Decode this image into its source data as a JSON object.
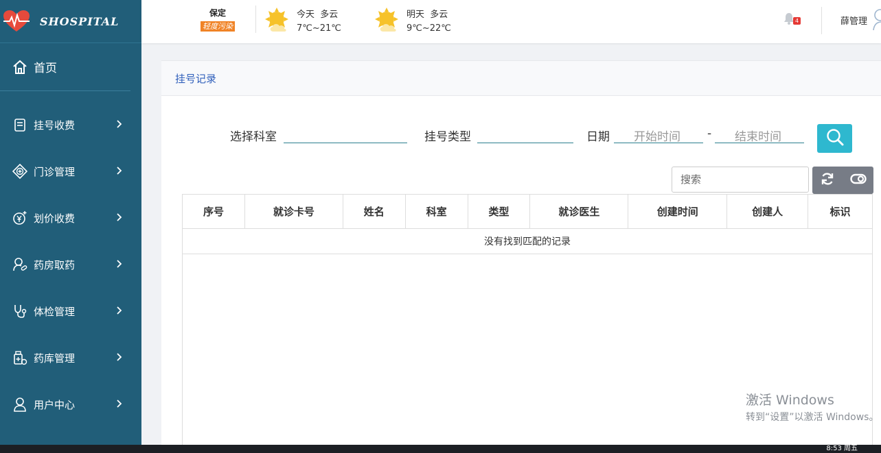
{
  "app": {
    "logo_text": "SHOSPITAL"
  },
  "sidebar": {
    "home": "首页",
    "items": [
      {
        "label": "挂号收费",
        "icon": "registration-icon"
      },
      {
        "label": "门诊管理",
        "icon": "clinic-icon"
      },
      {
        "label": "划价收费",
        "icon": "yuan-icon"
      },
      {
        "label": "药房取药",
        "icon": "pharmacy-icon"
      },
      {
        "label": "体检管理",
        "icon": "stethoscope-icon"
      },
      {
        "label": "药库管理",
        "icon": "medicine-store-icon"
      },
      {
        "label": "用户中心",
        "icon": "user-icon"
      }
    ]
  },
  "topbar": {
    "city": "保定",
    "air_quality": "轻度污染",
    "today": {
      "label": "今天",
      "condition": "多云",
      "temp": "7℃~21℃"
    },
    "tomorrow": {
      "label": "明天",
      "condition": "多云",
      "temp": "9℃~22℃"
    },
    "notifications": "4",
    "user": "薛管理"
  },
  "panel": {
    "title": "挂号记录",
    "filters": {
      "department_label": "选择科室",
      "type_label": "挂号类型",
      "date_label": "日期",
      "start_placeholder": "开始时间",
      "separator": "-",
      "end_placeholder": "结束时间"
    },
    "search_placeholder": "搜索",
    "table": {
      "columns": [
        "序号",
        "就诊卡号",
        "姓名",
        "科室",
        "类型",
        "就诊医生",
        "创建时间",
        "创建人",
        "标识"
      ],
      "empty_message": "没有找到匹配的记录"
    }
  },
  "watermark": {
    "line1": "激活 Windows",
    "line2": "转到“设置”以激活 Windows。"
  },
  "taskbar": {
    "clock": "8:53 周五"
  },
  "colors": {
    "sidebar": "#215e79",
    "accent": "#2eb8cf",
    "title": "#2f5fbb",
    "badge": "#e53935",
    "aqi": "#f08326"
  }
}
